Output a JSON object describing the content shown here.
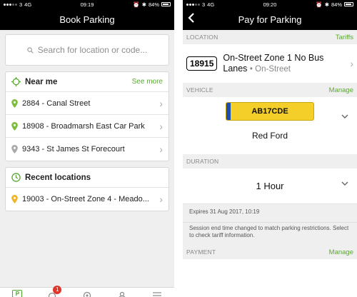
{
  "left": {
    "status": {
      "carrier": "3",
      "network": "4G",
      "time": "09:19",
      "battery": "84%"
    },
    "title": "Book Parking",
    "search": {
      "placeholder": "Search for location or code..."
    },
    "near_me": {
      "title": "Near me",
      "see_more": "See more",
      "items": [
        {
          "label": "2884 - Canal Street",
          "pin_color": "#7cbd3e"
        },
        {
          "label": "18908 - Broadmarsh East Car Park",
          "pin_color": "#7cbd3e"
        },
        {
          "label": "9343 - St James St Forecourt",
          "pin_color": "#a9a9a9"
        }
      ]
    },
    "recent": {
      "title": "Recent locations",
      "items": [
        {
          "label": "19003 - On-Street Zone 4 - Meado...",
          "pin_color": "#f0b429"
        }
      ]
    },
    "tabbar": {
      "parking_tab_letter": "P",
      "badge": "1"
    }
  },
  "right": {
    "status": {
      "carrier": "3",
      "network": "4G",
      "time": "09:20",
      "battery": "84%"
    },
    "title": "Pay for Parking",
    "back_label": "‹",
    "location": {
      "label": "LOCATION",
      "link": "Tariffs",
      "code": "18915",
      "name": "On-Street Zone 1 No Bus Lanes",
      "type": "• On-Street"
    },
    "vehicle": {
      "label": "VEHICLE",
      "link": "Manage",
      "plate": "AB17CDE",
      "name": "Red Ford"
    },
    "duration": {
      "label": "DURATION",
      "value": "1 Hour",
      "expires": "Expires 31 Aug 2017, 10:19",
      "notice": "Session end time changed to match parking restrictions. Select to check tariff information."
    },
    "payment": {
      "label": "PAYMENT",
      "link": "Manage"
    }
  },
  "colors": {
    "accent": "#5aa832",
    "plate": "#f4cf2a",
    "badge": "#e0352b"
  }
}
